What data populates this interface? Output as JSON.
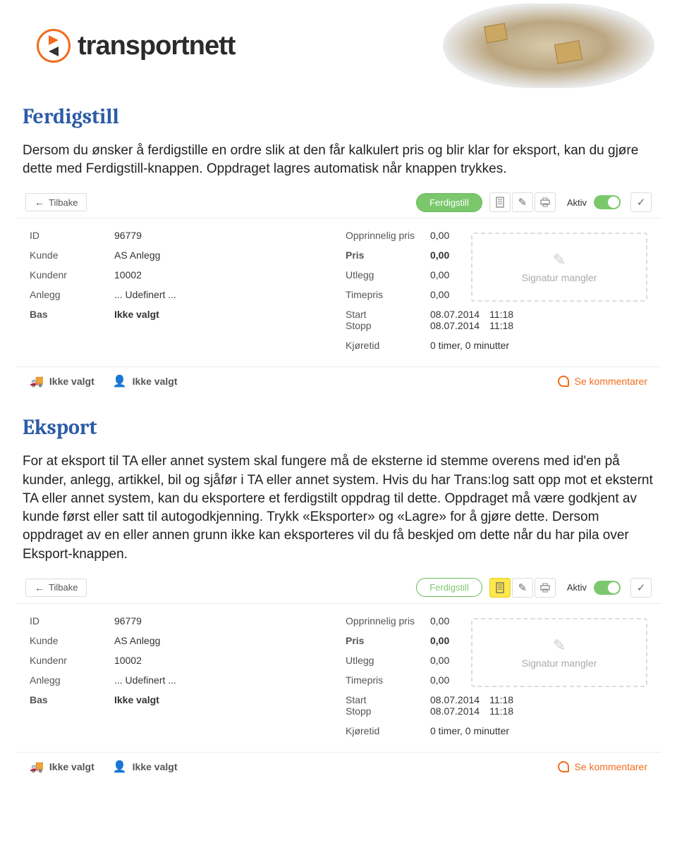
{
  "logo_text": "transportnett",
  "section1": {
    "title": "Ferdigstill",
    "para": "Dersom du ønsker å ferdigstille en ordre slik at den får kalkulert pris og blir klar for eksport, kan du gjøre dette med Ferdigstill-knappen. Oppdraget lagres automatisk når knappen trykkes."
  },
  "section2": {
    "title": "Eksport",
    "para": "For at eksport til TA eller annet system skal fungere må de eksterne id stemme overens med id'en på kunder, anlegg, artikkel, bil og sjåfør i TA eller annet system. Hvis du har Trans:log satt opp mot et eksternt TA eller annet system, kan du eksportere et ferdigstilt oppdrag til dette. Oppdraget må være godkjent av kunde først eller satt til autogodkjenning. Trykk «Eksporter» og «Lagre» for å gjøre dette. Dersom oppdraget av en eller annen grunn ikke kan eksporteres vil du få beskjed om dette når du har pila over Eksport-knappen."
  },
  "panel": {
    "back": "Tilbake",
    "ferdigstill": "Ferdigstill",
    "aktiv": "Aktiv",
    "left_rows": [
      {
        "lbl": "ID",
        "val": "96779",
        "bold": false
      },
      {
        "lbl": "Kunde",
        "val": "AS Anlegg",
        "bold": false
      },
      {
        "lbl": "Kundenr",
        "val": "10002",
        "bold": false
      },
      {
        "lbl": "Anlegg",
        "val": "... Udefinert ...",
        "bold": false
      },
      {
        "lbl": "Bas",
        "val": "Ikke valgt",
        "bold": true
      }
    ],
    "right_rows": [
      {
        "lbl": "Opprinnelig pris",
        "val": "0,00",
        "bold": false
      },
      {
        "lbl": "Pris",
        "val": "0,00",
        "bold": true
      },
      {
        "lbl": "Utlegg",
        "val": "0,00",
        "bold": false
      },
      {
        "lbl": "Timepris",
        "val": "0,00",
        "bold": false
      }
    ],
    "start_lbl": "Start",
    "start_date": "08.07.2014",
    "start_time": "11:18",
    "stopp_lbl": "Stopp",
    "stopp_date": "08.07.2014",
    "stopp_time": "11:18",
    "kjoretid_lbl": "Kjøretid",
    "kjoretid_val": "0 timer, 0 minutter",
    "signature": "Signatur mangler",
    "ikke_valgt": "Ikke valgt",
    "se_kommentarer": "Se kommentarer"
  }
}
